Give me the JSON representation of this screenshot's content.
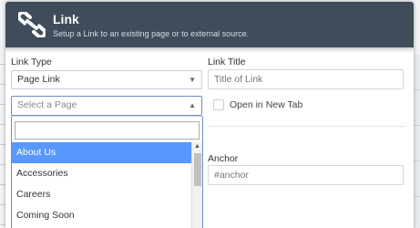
{
  "header": {
    "title": "Link",
    "subtitle": "Setup a Link to an existing page or to external source."
  },
  "form": {
    "link_type_label": "Link Type",
    "link_type_value": "Page Link",
    "link_title_label": "Link Title",
    "link_title_placeholder": "Title of Link",
    "page_select_placeholder": "Select a Page",
    "open_new_tab_label": "Open in New Tab",
    "open_new_tab_checked": false,
    "anchor_label": "Anchor",
    "anchor_value": "#anchor"
  },
  "dropdown": {
    "search_value": "",
    "items": [
      "About Us",
      "Accessories",
      "Careers",
      "Coming Soon"
    ],
    "highlighted_index": 0
  },
  "colors": {
    "header_bg": "#3f4c5a",
    "highlight": "#5897fb"
  }
}
